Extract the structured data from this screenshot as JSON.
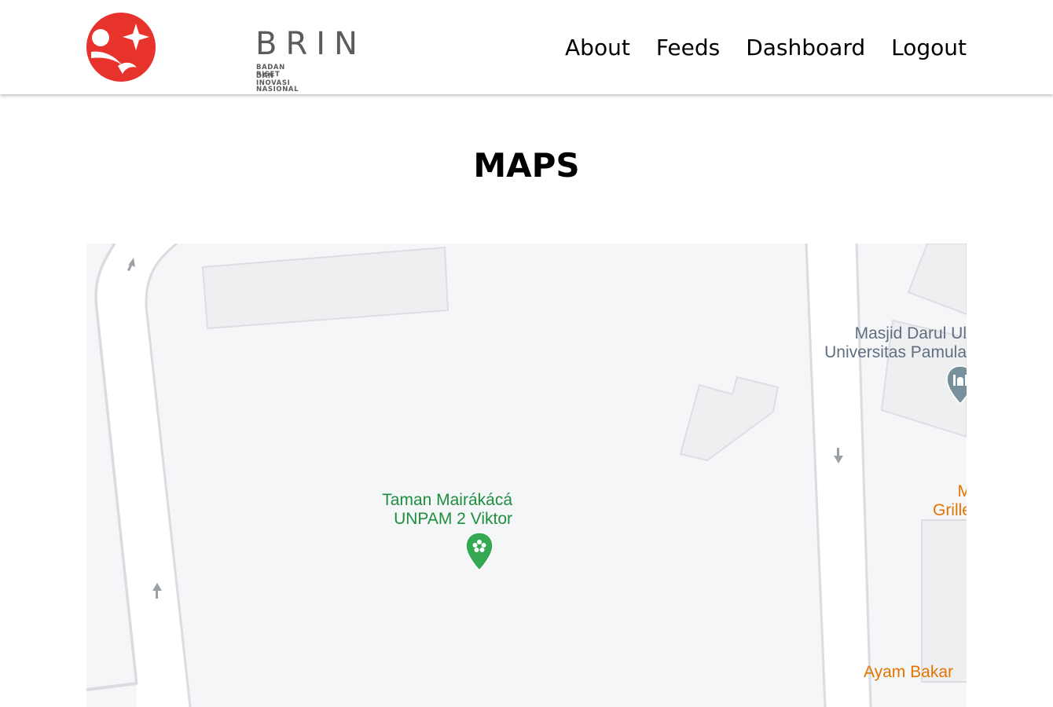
{
  "header": {
    "logo": {
      "wordmark": "BRIN",
      "subtitle_line1": "BADAN RISET",
      "subtitle_line2": "DAN INOVASI NASIONAL",
      "brand_color": "#e8322c"
    },
    "nav": [
      {
        "label": "About"
      },
      {
        "label": "Feeds"
      },
      {
        "label": "Dashboard"
      },
      {
        "label": "Logout"
      }
    ]
  },
  "page": {
    "title": "MAPS"
  },
  "map": {
    "places": [
      {
        "line1": "Taman Mairákácá",
        "line2": "UNPAM 2 Viktor",
        "icon": "park-pin-icon",
        "color": "#1e8e3e"
      },
      {
        "line1": "Masjid Darul Ul",
        "line2": "Universitas Pamula",
        "icon": "mosque-pin-icon",
        "color": "#5f6f80"
      },
      {
        "line1": "M",
        "line2": "Grille",
        "color": "#e37400"
      },
      {
        "line1": "Ayam Bakar",
        "color": "#e37400"
      }
    ]
  }
}
